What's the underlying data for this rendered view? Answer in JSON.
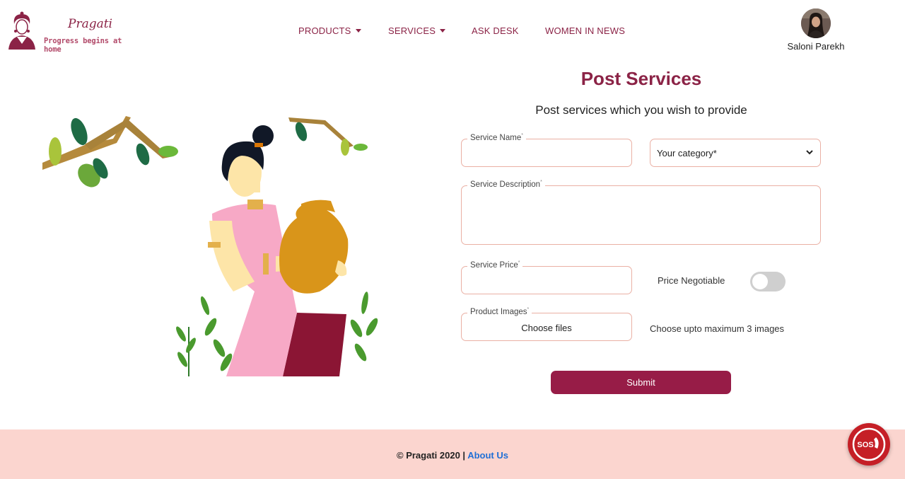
{
  "brand": {
    "name": "Pragati",
    "tagline": "Progress begins at home"
  },
  "nav": {
    "items": [
      {
        "label": "PRODUCTS",
        "has_dropdown": true
      },
      {
        "label": "SERVICES",
        "has_dropdown": true
      },
      {
        "label": "ASK DESK",
        "has_dropdown": false
      },
      {
        "label": "WOMEN IN NEWS",
        "has_dropdown": false
      }
    ]
  },
  "user": {
    "name": "Saloni Parekh"
  },
  "form": {
    "title": "Post Services",
    "subtitle": "Post services which you wish to provide",
    "service_name": {
      "label": "Service Name",
      "value": ""
    },
    "category": {
      "selected": "Your category*"
    },
    "service_description": {
      "label": "Service Description",
      "value": ""
    },
    "service_price": {
      "label": "Service Price",
      "value": ""
    },
    "price_negotiable": {
      "label": "Price Negotiable",
      "on": false
    },
    "product_images": {
      "label": "Product Images",
      "button": "Choose files",
      "hint": "Choose upto maximum 3 images"
    },
    "submit_label": "Submit",
    "required_mark": "*"
  },
  "footer": {
    "copyright": "© Pragati 2020 |",
    "link": "About Us"
  },
  "sos": {
    "label": "SOS"
  },
  "colors": {
    "brand": "#8b2346",
    "button": "#971c47",
    "footer_bg": "#fbd5cf",
    "link": "#1f6fd6",
    "field_border": "#eab0a4"
  },
  "icons": {
    "sos": "sos-phone-icon",
    "dropdown": "caret-down-icon",
    "select": "chevron-down-icon"
  }
}
